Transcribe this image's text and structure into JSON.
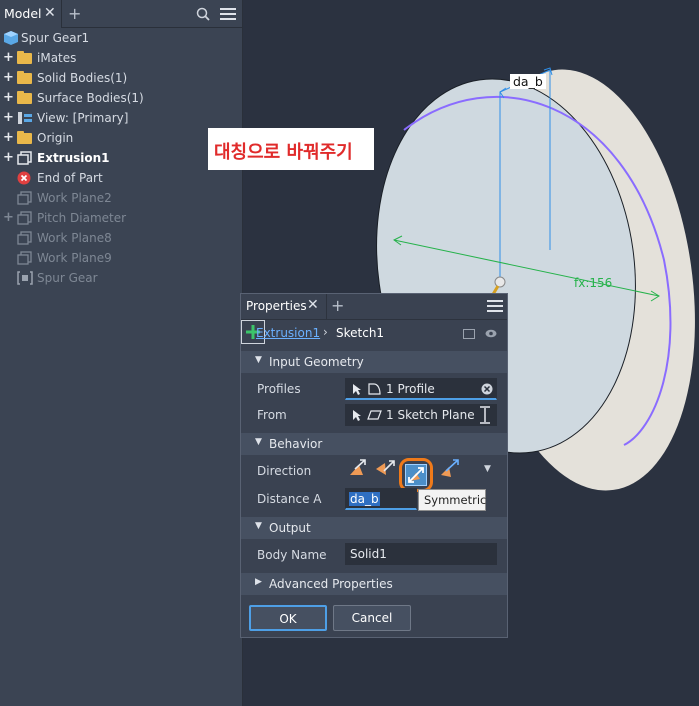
{
  "browser": {
    "tab_label": "Model",
    "tab_close": "✕",
    "tab_add": "+",
    "items": [
      {
        "label": "Spur Gear1"
      },
      {
        "label": "iMates",
        "expand": "+"
      },
      {
        "label": "Solid Bodies(1)",
        "expand": "+"
      },
      {
        "label": "Surface Bodies(1)",
        "expand": "+"
      },
      {
        "label": "View: [Primary]",
        "expand": "+"
      },
      {
        "label": "Origin",
        "expand": "+"
      },
      {
        "label": "Extrusion1",
        "expand": "+"
      },
      {
        "label": "End of Part"
      },
      {
        "label": "Work Plane2"
      },
      {
        "label": "Pitch Diameter",
        "expand": "+"
      },
      {
        "label": "Work Plane8"
      },
      {
        "label": "Work Plane9"
      },
      {
        "label": "Spur Gear"
      }
    ]
  },
  "viewport": {
    "callout": "대칭으로 바꿔주기",
    "dim_label_top": "da_b",
    "dim_label_fx": "fx:156"
  },
  "props": {
    "tab_label": "Properties",
    "tab_close": "✕",
    "tab_add": "+",
    "crumb_parent": "Extrusion1",
    "crumb_sep": "›",
    "crumb_current": "Sketch1",
    "section_input": "Input Geometry",
    "profiles_label": "Profiles",
    "profiles_value": "1 Profile",
    "from_label": "From",
    "from_value": "1 Sketch Plane",
    "section_behavior": "Behavior",
    "direction_label": "Direction",
    "distance_label": "Distance A",
    "distance_value": "da_b",
    "tooltip": "Symmetric",
    "section_output": "Output",
    "body_name_label": "Body Name",
    "body_name_value": "Solid1",
    "section_advanced": "Advanced Properties",
    "ok_label": "OK",
    "cancel_label": "Cancel",
    "add_label": "+"
  },
  "colors": {
    "accent_blue": "#4e9fe6",
    "highlight_orange": "#ef7a1a",
    "callout_red": "#e02b2b",
    "dim_green": "#26b24b",
    "edge_purple": "#8a6cff"
  }
}
